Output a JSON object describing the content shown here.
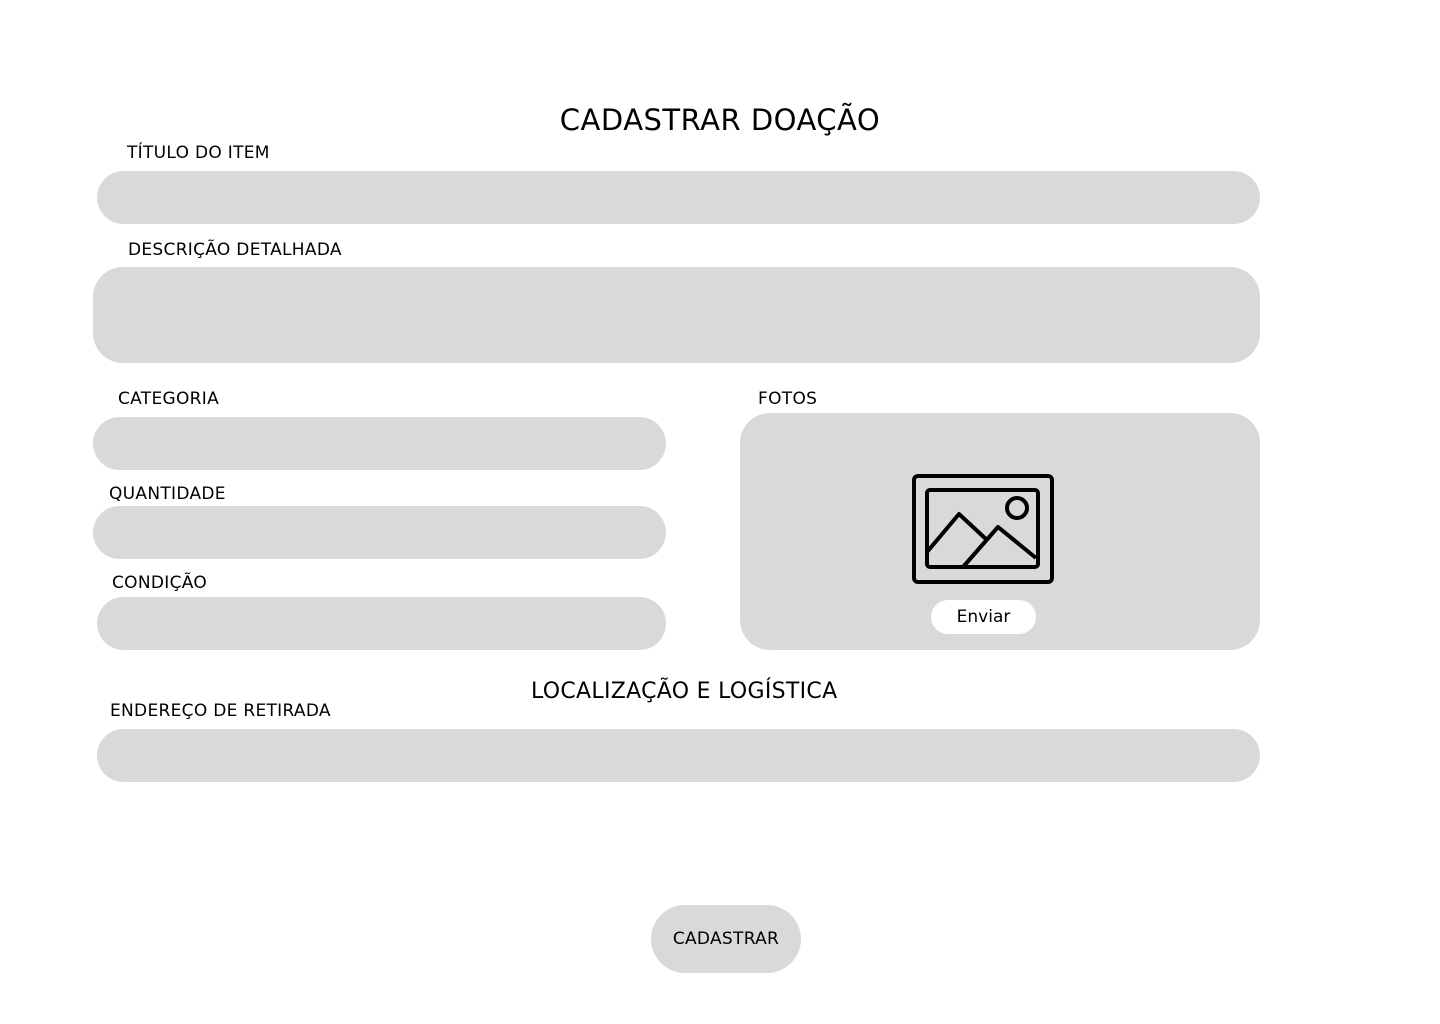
{
  "page": {
    "title": "CADASTRAR DOAÇÃO"
  },
  "form": {
    "title_label": "TÍTULO DO ITEM",
    "description_label": "DESCRIÇÃO DETALHADA",
    "category_label": "CATEGORIA",
    "quantity_label": "QUANTIDADE",
    "condition_label": "CONDIÇÃO",
    "photos_label": "FOTOS",
    "photos_icon": "image-icon",
    "send_button_label": "Enviar"
  },
  "logistics": {
    "section_title": "LOCALIZAÇÃO E LOGÍSTICA",
    "address_label": "ENDEREÇO DE RETIRADA"
  },
  "actions": {
    "submit_label": "CADASTRAR"
  },
  "colors": {
    "field_background": "#d9d9d9",
    "page_background": "#ffffff",
    "text": "#000000"
  }
}
